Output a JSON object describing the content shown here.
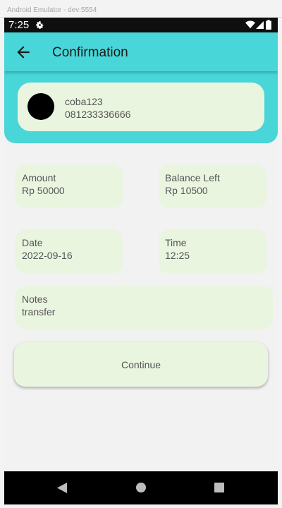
{
  "window": {
    "title": "Android Emulator - dev:5554"
  },
  "status_bar": {
    "time": "7:25",
    "icons": [
      "gear-icon",
      "wifi-icon",
      "signal-icon",
      "battery-icon"
    ]
  },
  "app_bar": {
    "title": "Confirmation",
    "back_icon": "arrow-left-icon"
  },
  "recipient": {
    "name": "coba123",
    "phone": "081233336666"
  },
  "details": {
    "amount": {
      "label": "Amount",
      "value": "Rp 50000"
    },
    "balance_left": {
      "label": "Balance Left",
      "value": "Rp 10500"
    },
    "date": {
      "label": "Date",
      "value": "2022-09-16"
    },
    "time": {
      "label": "Time",
      "value": "12:25"
    },
    "notes": {
      "label": "Notes",
      "value": "transfer"
    }
  },
  "actions": {
    "continue_label": "Continue"
  },
  "nav_bar": {
    "icons": [
      "back-triangle-icon",
      "home-circle-icon",
      "recents-square-icon"
    ]
  },
  "colors": {
    "accent": "#49d6d8",
    "card": "#eaf5e0",
    "background": "#f2f2f2",
    "text": "#555555"
  }
}
